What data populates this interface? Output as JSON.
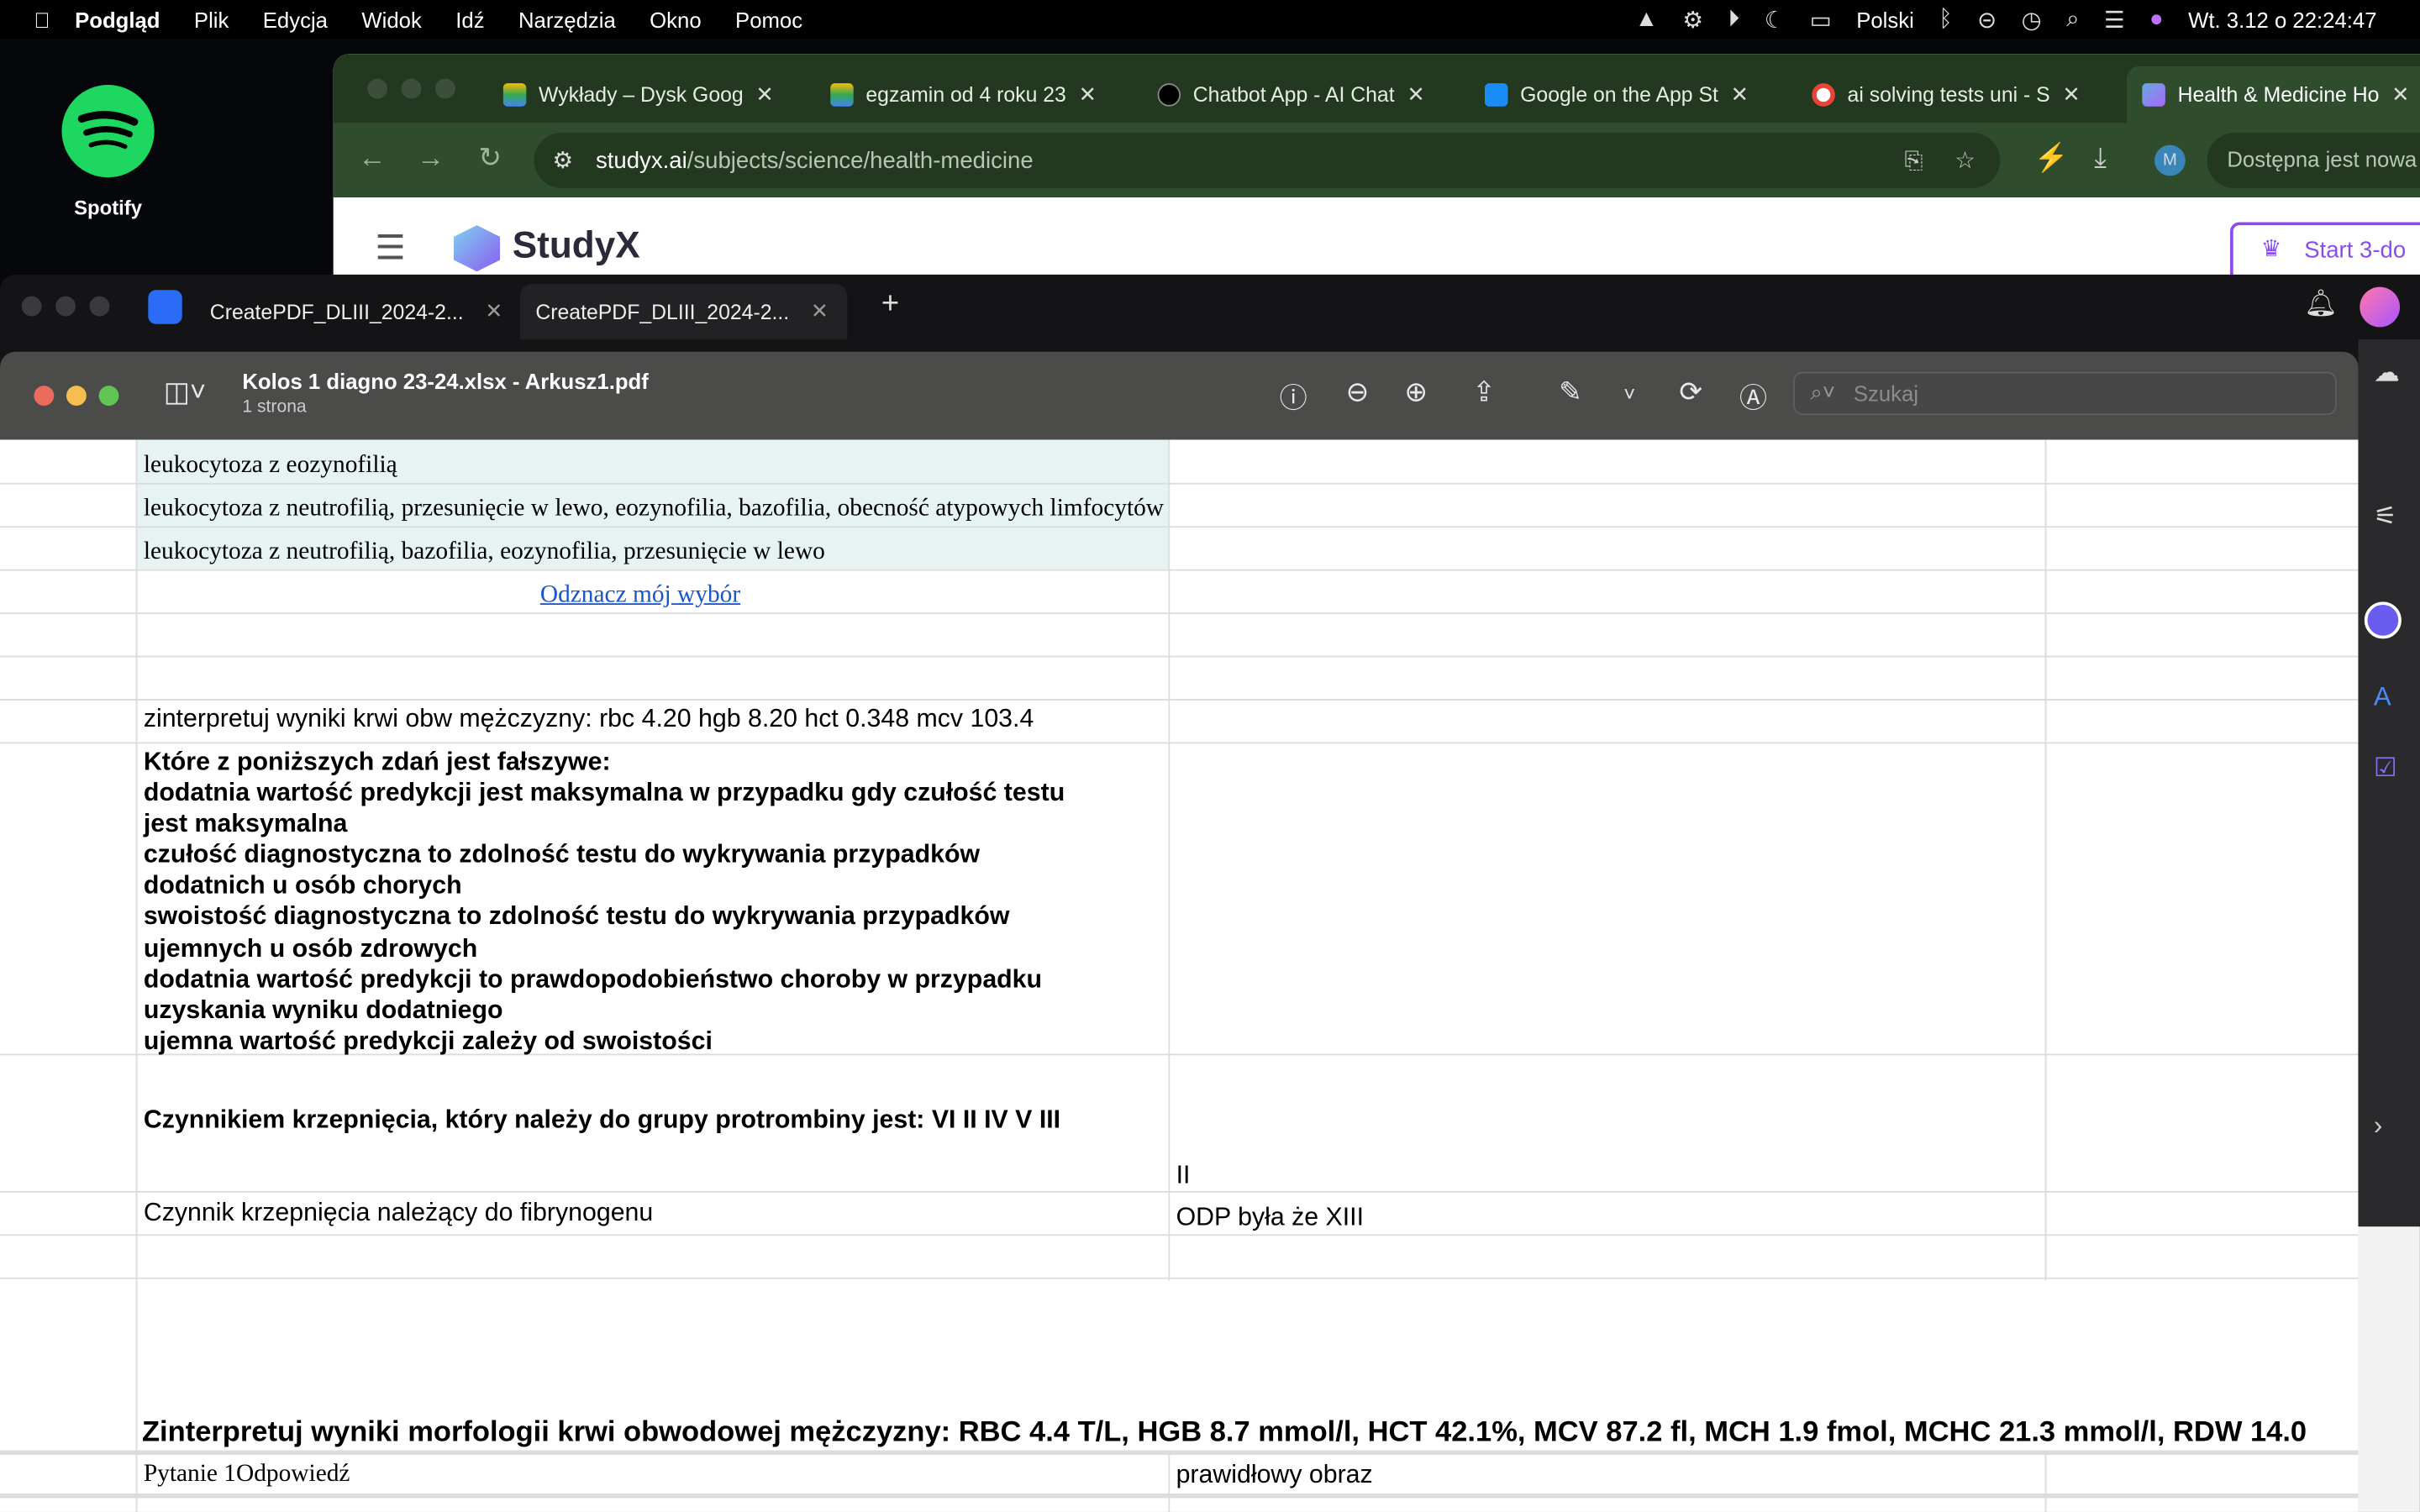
{
  "menubar": {
    "app": "Podgląd",
    "items": [
      "Plik",
      "Edycja",
      "Widok",
      "Idź",
      "Narzędzia",
      "Okno",
      "Pomoc"
    ],
    "language": "Polski",
    "datetime": "Wt. 3.12 o 22:24:47"
  },
  "desktop": {
    "spotify_label": "Spotify"
  },
  "chrome": {
    "tabs": [
      {
        "label": "Wykłady – Dysk Goog"
      },
      {
        "label": "egzamin od 4 roku 23"
      },
      {
        "label": "Chatbot App - AI Chat"
      },
      {
        "label": "Google on the App St"
      },
      {
        "label": "ai solving tests uni - S"
      },
      {
        "label": "Health & Medicine Ho"
      }
    ],
    "url_host": "studyx.ai",
    "url_path": "/subjects/science/health-medicine",
    "profile_initial": "M",
    "update_label": "Dostępna jest nowa",
    "page": {
      "logo": "StudyX",
      "start_button": "Start 3-do"
    }
  },
  "pdfapp": {
    "tabs": [
      {
        "label": "CreatePDF_DLIII_2024-2..."
      },
      {
        "label": "CreatePDF_DLIII_2024-2..."
      }
    ]
  },
  "preview": {
    "title": "Kolos 1 diagno 23-24.xlsx - Arkusz1.pdf",
    "subtitle": "1 strona",
    "search_placeholder": "Szukaj"
  },
  "document": {
    "rows": {
      "r1": "leukocytoza z eozynofilią",
      "r2": "leukocytoza z neutrofilią, przesunięcie w lewo, eozynofilia, bazofilia, obecność atypowych limfocytów",
      "r3": "leukocytoza z neutrofilią, bazofilia, eozynofilia, przesunięcie w lewo",
      "link": "Odznacz mój wybór",
      "q1": "zinterpretuj wyniki krwi obw mężczyzny: rbc 4.20 hgb 8.20 hct 0.348 mcv 103.4",
      "q2_lines": [
        "Które z poniższych zdań jest fałszywe:",
        "dodatnia wartość predykcji jest maksymalna w przypadku gdy czułość testu",
        "jest maksymalna",
        "czułość diagnostyczna to zdolność testu do wykrywania przypadków",
        "dodatnich u osób chorych",
        "swoistość diagnostyczna to  zdolność testu do wykrywania przypadków",
        "ujemnych u osób zdrowych",
        "dodatnia wartość predykcji to prawdopodobieństwo choroby w przypadku",
        "uzyskania wyniku dodatniego",
        "ujemna wartość predykcji zależy od swoistości"
      ],
      "q3": "Czynnikiem krzepnięcia, który należy do grupy protrombiny jest: VI II IV V III",
      "q3_answer": "II",
      "q4": "Czynnik krzepnięcia należący do fibrynogenu",
      "q4_answer": "ODP była że XIII",
      "q5": "Zinterpretuj wyniki morfologii krwi obwodowej mężczyzny: RBC 4.4 T/L, HGB 8.7 mmol/l, HCT 42.1%, MCV 87.2 fl, MCH 1.9 fmol, MCHC 21.3 mmol/l, RDW 14.0",
      "q6": "Pytanie 1Odpowiedź",
      "q6_answer": "prawidłowy obraz"
    }
  },
  "colors": {
    "chrome_tabbar": "#22381f",
    "chrome_toolbar": "#2f4d2c",
    "spotify": "#1ed760",
    "highlight": "#e7f3f3",
    "link": "#1a55cc"
  }
}
